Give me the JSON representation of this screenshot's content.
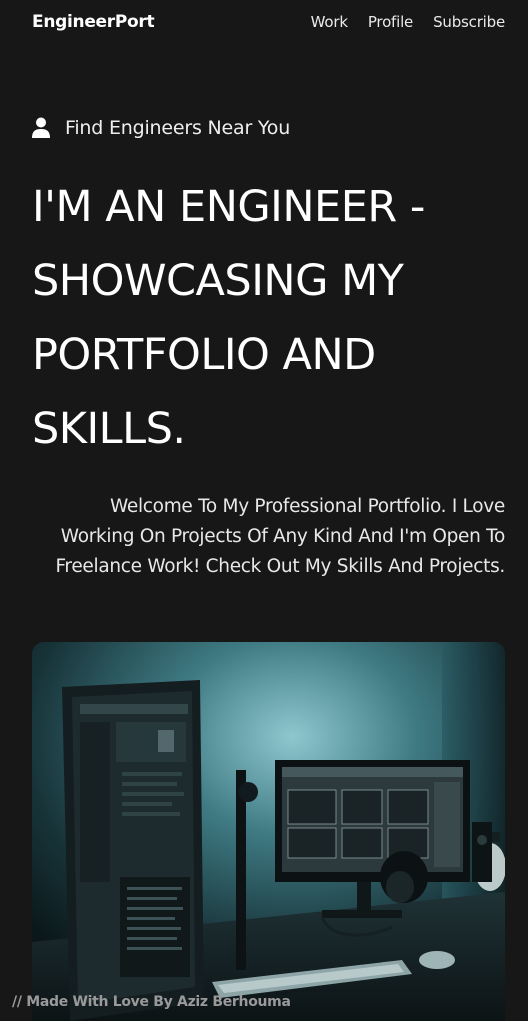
{
  "nav": {
    "brand": "EngineerPort",
    "links": [
      "Work",
      "Profile",
      "Subscribe"
    ]
  },
  "hero": {
    "eyebrow": "Find Engineers Near You",
    "eyebrow_icon": "user-icon",
    "headline": "I'm An Engineer - Showcasing My Portfolio And Skills.",
    "intro": "Welcome To My Professional Portfolio. I Love Working On Projects Of Any Kind And I'm Open To Freelance Work! Check Out My Skills And Projects."
  },
  "photo": {
    "description_icon": "workspace-photo"
  },
  "footer": {
    "credit": "// Made With Love By Aziz Berhouma"
  },
  "colors": {
    "background": "#171717",
    "text": "#ffffff",
    "muted": "#9a9a9a"
  }
}
